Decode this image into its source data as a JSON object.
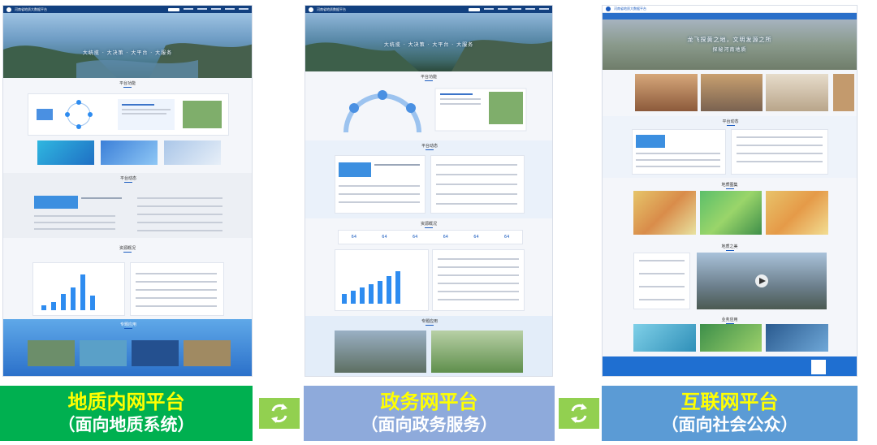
{
  "platforms": [
    {
      "id": "intranet",
      "label_main": "地质内网平台",
      "label_sub": "（面向地质系统）",
      "color": "#00b050",
      "screenshot": {
        "site_title": "河南省地质大数据平台",
        "hero_slogan": "大统揽 · 大决策 · 大平台 · 大服务",
        "sections": [
          "平台功能",
          "平台动态",
          "资源概况",
          "专题应用"
        ]
      }
    },
    {
      "id": "government",
      "label_main": "政务网平台",
      "label_sub": "（面向政务服务）",
      "color": "#8eaadb",
      "screenshot": {
        "site_title": "河南省地质数据平台",
        "hero_slogan": "大统揽 · 大决策 · 大平台 · 大服务",
        "sections": [
          "平台功能",
          "平台动态",
          "资源概况",
          "专题应用"
        ],
        "stat_values": [
          "64",
          "64",
          "64",
          "64",
          "64",
          "64"
        ]
      }
    },
    {
      "id": "internet",
      "label_main": "互联网平台",
      "label_sub": "（面向社会公众）",
      "color": "#5b9bd5",
      "screenshot": {
        "site_title": "河南省地质大数据平台",
        "hero_slogan_1": "龙飞探黄之地，文明发源之所",
        "hero_slogan_2": "探秘河南地质",
        "sections": [
          "平台动态",
          "地质图集",
          "地质之美",
          "业务应用"
        ]
      }
    }
  ],
  "connector_color": "#92d050"
}
